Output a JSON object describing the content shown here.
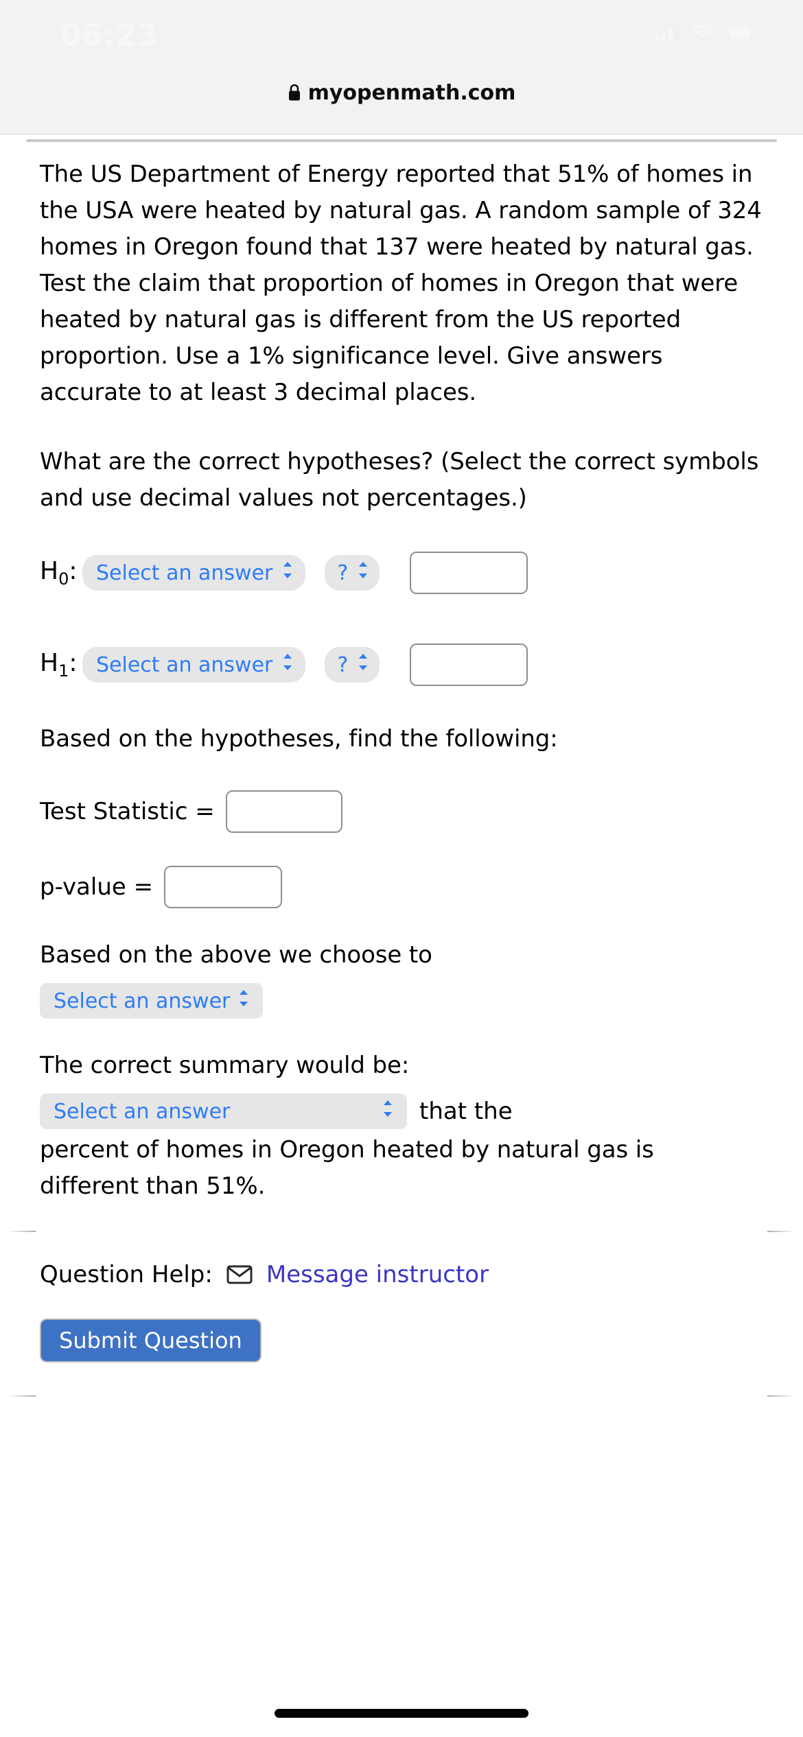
{
  "status_bar": {
    "time": "06:23",
    "icons": [
      "cellular-signal-icon",
      "wifi-icon",
      "battery-icon"
    ]
  },
  "browser": {
    "lock_icon": "lock-icon",
    "url": "myopenmath.com"
  },
  "question": {
    "body": "The US Department of Energy reported that 51% of homes in the USA were heated by natural gas. A random sample of 324 homes in Oregon found that 137 were heated by natural gas. Test the claim that proportion of homes in Oregon that were heated by natural gas is different from the US reported proportion. Use a 1% significance level. Give answers accurate to at least 3 decimal places.",
    "hypotheses_prompt": "What are the correct hypotheses? (Select the correct symbols and use decimal values not percentages.)",
    "h0_label": "H",
    "h0_sub": "0",
    "h0_colon": ":",
    "h1_label": "H",
    "h1_sub": "1",
    "h1_colon": ":",
    "select_placeholder": "Select an answer",
    "symbol_placeholder": "?",
    "h0_value": "",
    "h0_symbol_value": "",
    "h0_input_value": "",
    "h1_value": "",
    "h1_symbol_value": "",
    "h1_input_value": "",
    "based_on_hypotheses": "Based on the hypotheses, find the following:",
    "test_statistic_label": "Test Statistic  =",
    "test_statistic_value": "",
    "p_value_label": "p-value  =",
    "p_value_value": "",
    "choose_to_label": "Based on the above we choose to",
    "decision_value": "Select an answer",
    "summary_label": "The correct summary would be:",
    "summary_value": "Select an answer",
    "summary_trailing": "that the",
    "summary_tail_line1": "percent of homes in Oregon heated by natural gas is",
    "summary_tail_line2": "different than 51%."
  },
  "footer": {
    "question_help_label": "Question Help:",
    "mail_icon": "mail-icon",
    "message_instructor": "Message instructor",
    "submit_label": "Submit Question"
  },
  "colors": {
    "link_blue": "#2f7cf6",
    "instructor_link": "#3b34c4",
    "submit_bg": "#3d72c4",
    "pill_bg": "#e6e6e6",
    "chrome_bg": "#f2f2f2"
  }
}
